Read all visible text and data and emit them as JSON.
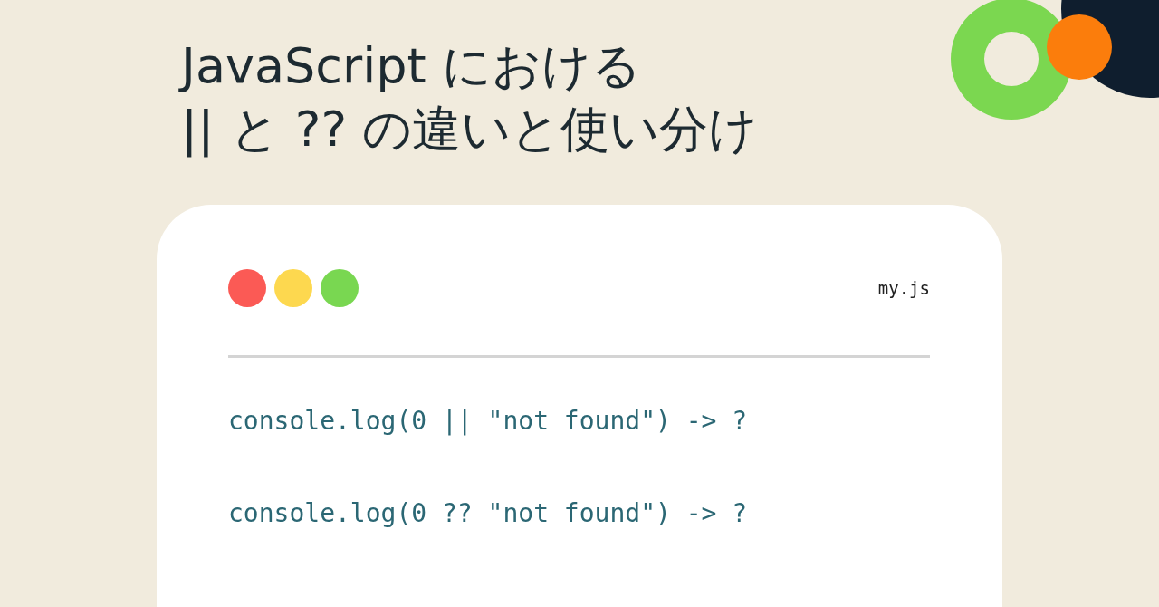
{
  "title": [
    "JavaScript における",
    "|| と ?? の違いと使い分け"
  ],
  "code_window": {
    "dots": [
      {
        "color": "#fb5a55"
      },
      {
        "color": "#fdd84f"
      },
      {
        "color": "#79d751"
      }
    ],
    "filename": "my.js",
    "lines": [
      "console.log(0 || \"not found\") -> ?",
      "console.log(0 ?? \"not found\") -> ?"
    ]
  }
}
